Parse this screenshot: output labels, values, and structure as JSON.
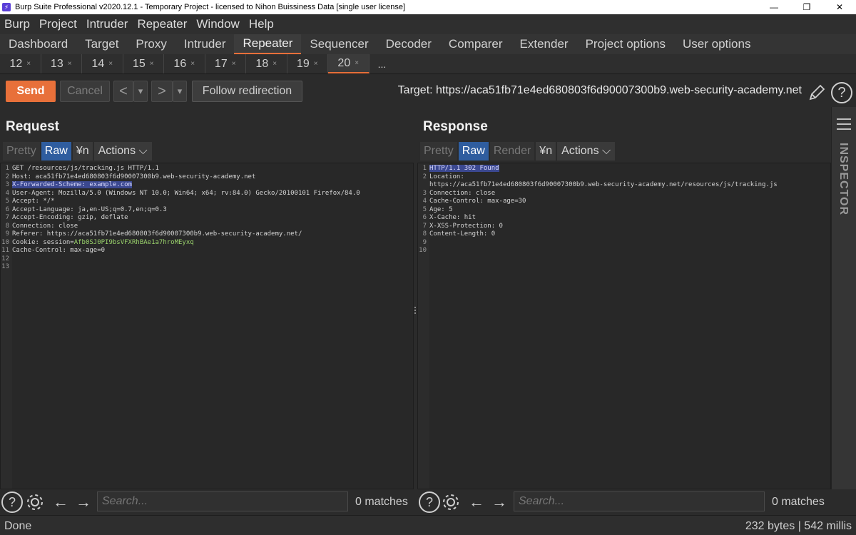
{
  "window": {
    "title": "Burp Suite Professional v2020.12.1 - Temporary Project - licensed to Nihon Buissiness Data [single user license]",
    "minimize": "—",
    "restore": "❐",
    "close": "✕"
  },
  "menu": [
    "Burp",
    "Project",
    "Intruder",
    "Repeater",
    "Window",
    "Help"
  ],
  "main_tabs": [
    "Dashboard",
    "Target",
    "Proxy",
    "Intruder",
    "Repeater",
    "Sequencer",
    "Decoder",
    "Comparer",
    "Extender",
    "Project options",
    "User options"
  ],
  "main_tab_active": "Repeater",
  "sub_tabs": [
    "12",
    "13",
    "14",
    "15",
    "16",
    "17",
    "18",
    "19",
    "20"
  ],
  "sub_tab_active": "20",
  "sub_tab_more": "...",
  "toolbar": {
    "send": "Send",
    "cancel": "Cancel",
    "back": "<",
    "forward": ">",
    "dropdown": "▾",
    "follow": "Follow redirection",
    "target": "Target: https://aca51fb71e4ed680803f6d90007300b9.web-security-academy.net",
    "help": "?"
  },
  "request": {
    "title": "Request",
    "views": [
      "Pretty",
      "Raw",
      "¥n",
      "Actions ⌵"
    ],
    "lines": [
      "GET /resources/js/tracking.js HTTP/1.1",
      "Host: aca51fb71e4ed680803f6d90007300b9.web-security-academy.net",
      "X-Forwarded-Scheme: example.com",
      "User-Agent: Mozilla/5.0 (Windows NT 10.0; Win64; x64; rv:84.0) Gecko/20100101 Firefox/84.0",
      "Accept: */*",
      "Accept-Language: ja,en-US;q=0.7,en;q=0.3",
      "Accept-Encoding: gzip, deflate",
      "Connection: close",
      "Referer: https://aca51fb71e4ed680803f6d90007300b9.web-security-academy.net/",
      "Cookie: session=Afb0SJ0PI9bsVFXRhBAe1a7hroMEyxq",
      "Cache-Control: max-age=0",
      "",
      ""
    ],
    "cookie_label": "Cookie: session=",
    "cookie_value": "Afb0SJ0PI9bsVFXRhBAe1a7hroMEyxq"
  },
  "response": {
    "title": "Response",
    "views": [
      "Pretty",
      "Raw",
      "Render",
      "¥n",
      "Actions ⌵"
    ],
    "lines": [
      "HTTP/1.1 302 Found",
      "Location:",
      "https://aca51fb71e4ed680803f6d90007300b9.web-security-academy.net/resources/js/tracking.js",
      "Connection: close",
      "Cache-Control: max-age=30",
      "Age: 5",
      "X-Cache: hit",
      "X-XSS-Protection: 0",
      "Content-Length: 0",
      "",
      ""
    ],
    "line_numbers": [
      "1",
      "2",
      "",
      "3",
      "4",
      "5",
      "6",
      "7",
      "8",
      "9",
      "10"
    ]
  },
  "inspector": {
    "label": "INSPECTOR"
  },
  "search": {
    "placeholder": "Search...",
    "req_matches": "0 matches",
    "resp_matches": "0 matches",
    "help": "?",
    "prev": "←",
    "next": "→"
  },
  "status": {
    "left": "Done",
    "right": "232 bytes | 542 millis"
  },
  "colors": {
    "accent": "#e8703a",
    "selected_view": "#2f5d9f",
    "highlight": "#3b4890"
  }
}
